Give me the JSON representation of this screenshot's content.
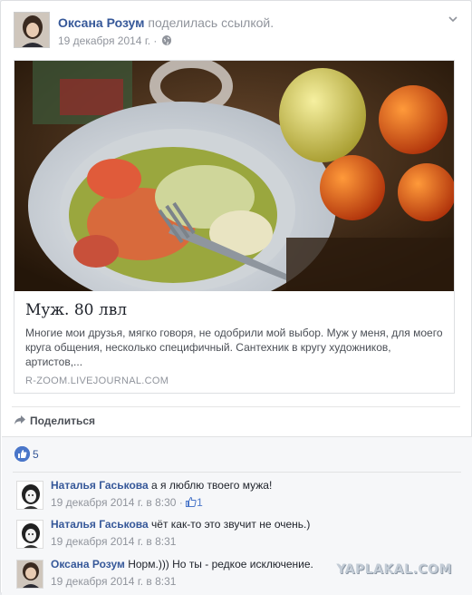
{
  "post": {
    "author": "Оксана Розум",
    "action": "поделилась ссылкой.",
    "date": "19 декабря 2014 г.",
    "separator": "·",
    "privacy_icon": "globe-icon",
    "menu_icon": "chevron-down-icon"
  },
  "link": {
    "title": "Муж. 80 лвл",
    "description": "Многие мои друзья, мягко говоря, не одобрили мой выбор. Муж у меня, для моего круга общения, несколько специфичный. Сантехник  в кругу художников, артистов,...",
    "domain": "R-ZOOM.LIVEJOURNAL.COM"
  },
  "actions": {
    "share_label": "Поделиться"
  },
  "likes": {
    "count": "5"
  },
  "comments": [
    {
      "author": "Наталья Гаськова",
      "text": "а я люблю твоего мужа!",
      "time": "19 декабря 2014 г. в 8:30",
      "sep": "·",
      "likes": "1"
    },
    {
      "author": "Наталья Гаськова",
      "text": "чёт как-то это звучит не очень.)",
      "time": "19 декабря 2014 г. в 8:31",
      "sep": "·"
    },
    {
      "author": "Оксана Розум",
      "text": "Норм.))) Но ты - редкое исключение.",
      "time": "19 декабря 2014 г. в 8:31",
      "sep": "·"
    }
  ],
  "watermark": "YAPLAKAL.COM",
  "colors": {
    "link_blue": "#365899",
    "meta_gray": "#90949c",
    "like_blue": "#4a76c9"
  }
}
